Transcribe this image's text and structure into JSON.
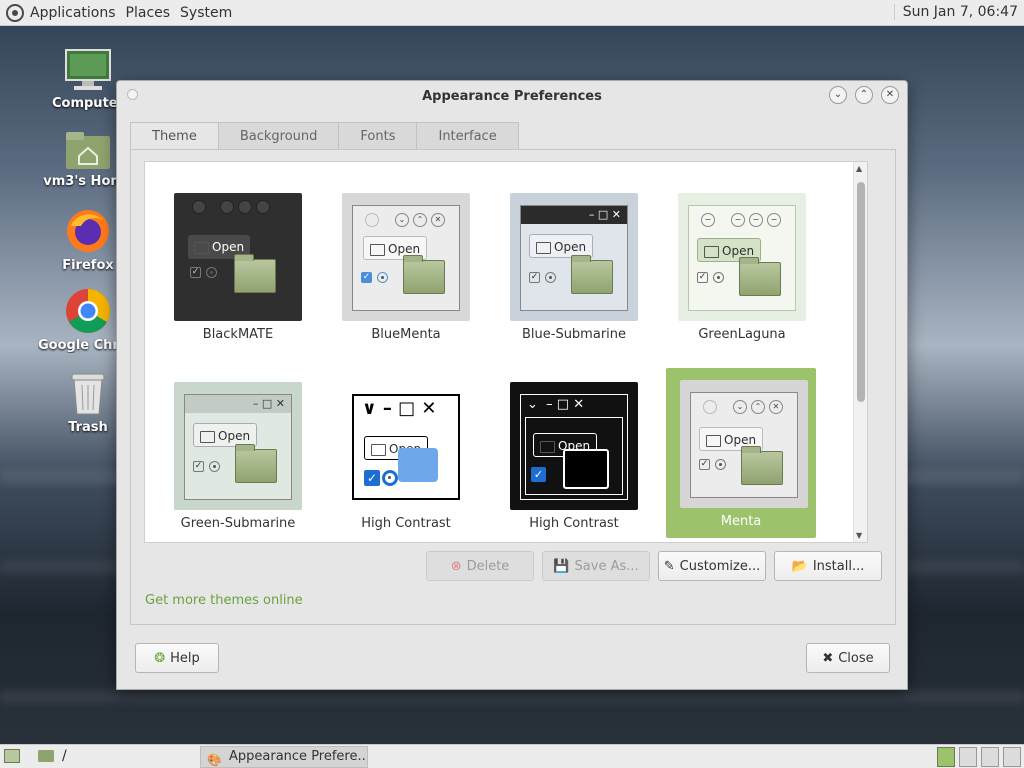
{
  "top_panel": {
    "menus": [
      "Applications",
      "Places",
      "System"
    ],
    "clock": "Sun Jan  7, 06:47"
  },
  "desktop": {
    "icons": [
      {
        "label": "Computer",
        "icon": "computer-icon"
      },
      {
        "label": "vm3's Home",
        "icon": "home-folder-icon"
      },
      {
        "label": "Firefox",
        "icon": "firefox-icon"
      },
      {
        "label": "Google Chrome",
        "icon": "chrome-icon"
      },
      {
        "label": "Trash",
        "icon": "trash-icon"
      }
    ]
  },
  "window": {
    "title": "Appearance Preferences",
    "tabs": [
      "Theme",
      "Background",
      "Fonts",
      "Interface"
    ],
    "active_tab": "Theme",
    "themes": [
      {
        "name": "BlackMATE"
      },
      {
        "name": "BlueMenta"
      },
      {
        "name": "Blue-Submarine"
      },
      {
        "name": "GreenLaguna"
      },
      {
        "name": "Green-Submarine"
      },
      {
        "name": "High Contrast"
      },
      {
        "name": "High Contrast"
      },
      {
        "name": "Menta",
        "selected": true
      }
    ],
    "preview_open_label": "Open",
    "buttons": {
      "delete": "Delete",
      "save_as": "Save As...",
      "customize": "Customize...",
      "install": "Install..."
    },
    "more_themes_link": "Get more themes online",
    "help": "Help",
    "close": "Close"
  },
  "bottom_panel": {
    "path": "/",
    "task_label": "Appearance Prefere..."
  },
  "colors": {
    "selection": "#9cc36c",
    "link": "#6aa23d"
  }
}
